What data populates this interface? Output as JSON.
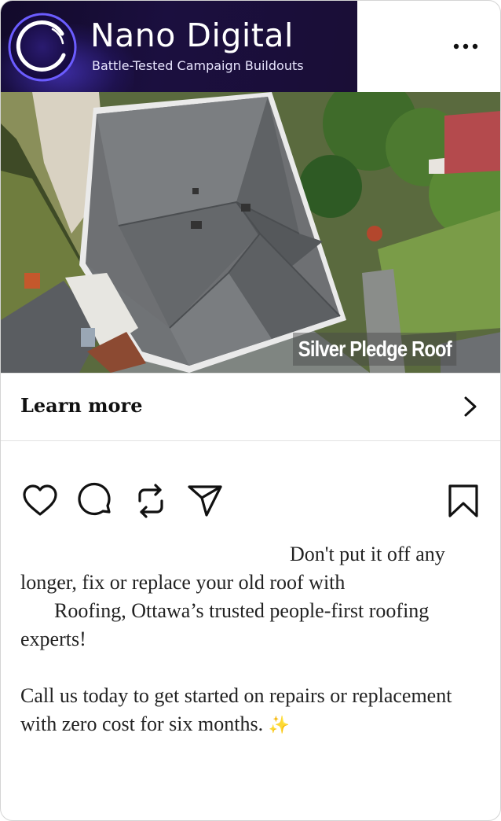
{
  "brand": {
    "name": "Nano Digital",
    "tagline": "Battle-Tested Campaign Buildouts"
  },
  "menu": {
    "more_icon": "more-horizontal-icon"
  },
  "media": {
    "overlay_text": "Silver Pledge Roof"
  },
  "cta": {
    "label": "Learn more",
    "icon": "chevron-right-icon"
  },
  "actions": {
    "like_icon": "heart-icon",
    "comment_icon": "comment-icon",
    "repost_icon": "repost-icon",
    "share_icon": "send-icon",
    "save_icon": "bookmark-icon"
  },
  "caption": {
    "line1": "Don't put it off any longer, fix or replace your old roof with",
    "line2": "Roofing, Ottawa’s trusted people-first roofing experts!",
    "para2": "Call us today to get started on repairs or replacement with zero cost for six months.",
    "emoji": "✨"
  },
  "colors": {
    "brand_bg": "#1a0e36",
    "text": "#222222",
    "divider": "#e2e2e2"
  }
}
